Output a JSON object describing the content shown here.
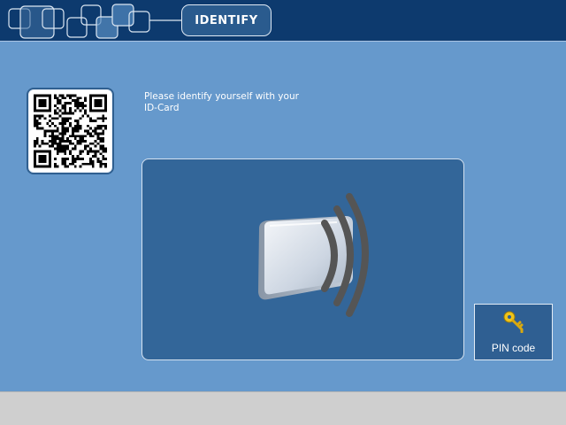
{
  "header": {
    "title": "IDENTIFY"
  },
  "main": {
    "instruction": "Please identify yourself with your ID-Card"
  },
  "pin_button": {
    "label": "PIN code",
    "icon": "key-icon"
  },
  "colors": {
    "header_bg": "#0d3a6e",
    "main_bg": "#6699cc",
    "panel_bg": "#336699",
    "button_bg": "#2f5f92",
    "key_gold": "#f0c419"
  }
}
